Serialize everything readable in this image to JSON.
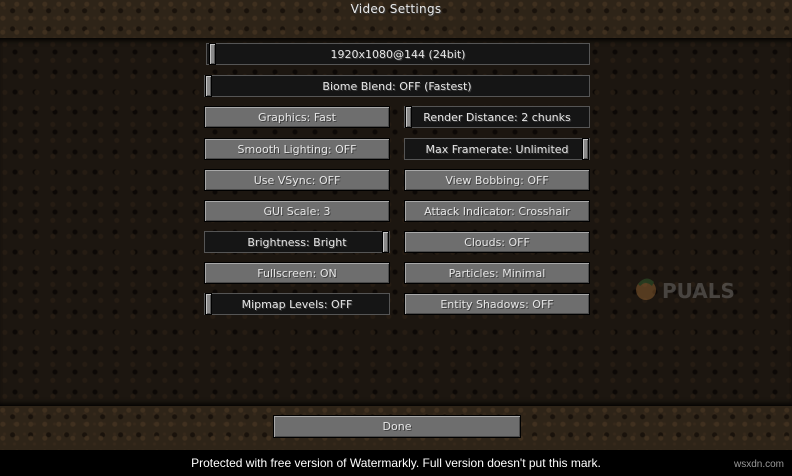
{
  "title": "Video Settings",
  "sliders": {
    "resolution": {
      "label": "1920x1080@144 (24bit)",
      "value": 0.02
    },
    "biome_blend": {
      "label": "Biome Blend: OFF (Fastest)",
      "value": 0.0
    },
    "render_distance": {
      "label": "Render Distance: 2 chunks",
      "value": 0.0
    },
    "max_framerate": {
      "label": "Max Framerate: Unlimited",
      "value": 1.0
    },
    "brightness": {
      "label": "Brightness: Bright",
      "value": 1.0
    },
    "mipmap_levels": {
      "label": "Mipmap Levels: OFF",
      "value": 0.0
    }
  },
  "buttons": {
    "graphics": "Graphics: Fast",
    "smooth_lighting": "Smooth Lighting: OFF",
    "vsync": "Use VSync: OFF",
    "view_bobbing": "View Bobbing: OFF",
    "gui_scale": "GUI Scale: 3",
    "attack_indicator": "Attack Indicator: Crosshair",
    "clouds": "Clouds: OFF",
    "fullscreen": "Fullscreen: ON",
    "particles": "Particles: Minimal",
    "entity_shadows": "Entity Shadows: OFF",
    "done": "Done"
  },
  "watermark": {
    "text": "Protected with free version of Watermarkly. Full version doesn't put this mark.",
    "site": "wsxdn.com",
    "logo_text": "PUALS"
  },
  "colors": {
    "button_face": "#6e6e6e",
    "slider_track": "#151515",
    "text": "#e6e6e6"
  }
}
